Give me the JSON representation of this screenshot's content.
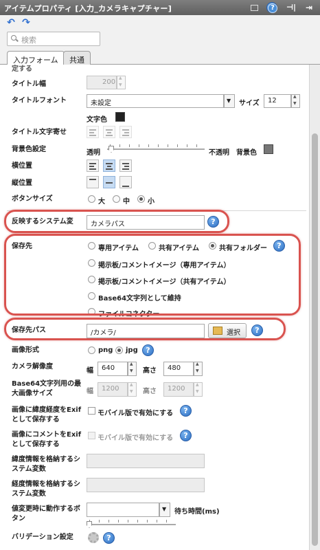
{
  "window": {
    "title": "アイテムプロパティ [入力_カメラキャプチャー]",
    "pin_glyph": "⊣|",
    "close_glyph": "⇥"
  },
  "toolbar": {
    "undo_glyph": "↶",
    "redo_glyph": "↷"
  },
  "search": {
    "placeholder": "検索"
  },
  "tabs": [
    {
      "label": "入力フォーム"
    },
    {
      "label": "共通"
    }
  ],
  "rows": {
    "truncated_top": "定する",
    "title_width": {
      "label": "タイトル幅",
      "value": "200"
    },
    "title_font": {
      "label": "タイトルフォント",
      "value": "未設定",
      "size_label": "サイズ",
      "size_value": "12",
      "color_label": "文字色"
    },
    "title_align": {
      "label": "タイトル文字寄せ"
    },
    "bg": {
      "label": "背景色設定",
      "left": "透明",
      "right": "不透明",
      "color_label": "背景色"
    },
    "halign": {
      "label": "横位置"
    },
    "valign": {
      "label": "縦位置"
    },
    "button_size": {
      "label": "ボタンサイズ",
      "options": [
        "大",
        "中",
        "小"
      ],
      "selected": "小"
    },
    "system_var": {
      "label": "反映するシステム変",
      "value": "カメラパス"
    },
    "save_dest": {
      "label": "保存先",
      "options": [
        "専用アイテム",
        "共有アイテム",
        "共有フォルダー",
        "掲示板/コメントイメージ（専用アイテム）",
        "掲示板/コメントイメージ（共有アイテム）",
        "Base64文字列として維持",
        "ファイルコネクター"
      ],
      "selected": "共有フォルダー"
    },
    "save_path": {
      "label": "保存先パス",
      "value": "/カメラ/",
      "button": "選択"
    },
    "image_format": {
      "label": "画像形式",
      "options": [
        "png",
        "jpg"
      ],
      "selected": "jpg"
    },
    "camera_res": {
      "label": "カメラ解像度",
      "w_label": "幅",
      "w_value": "640",
      "h_label": "高さ",
      "h_value": "480"
    },
    "base64_max": {
      "label": "Base64文字列用の最大画像サイズ",
      "w_label": "幅",
      "w_value": "1200",
      "h_label": "高さ",
      "h_value": "1200"
    },
    "exif_latlng": {
      "label": "画像に緯度経度をExifとして保存する",
      "check_label": "モバイル版で有効にする"
    },
    "exif_comment": {
      "label": "画像にコメントをExifとして保存する",
      "check_label": "モバイル版で有効にする"
    },
    "lat_var": {
      "label": "緯度情報を格納するシステム変数"
    },
    "lng_var": {
      "label": "経度情報を格納するシステム変数"
    },
    "change_button": {
      "label": "値変更時に動作するボタン",
      "wait_label": "待ち時間(ms)"
    },
    "validation": {
      "label": "バリデーション設定"
    }
  },
  "colors": {
    "highlight": "#d9534f",
    "accent": "#2d6fc4"
  }
}
